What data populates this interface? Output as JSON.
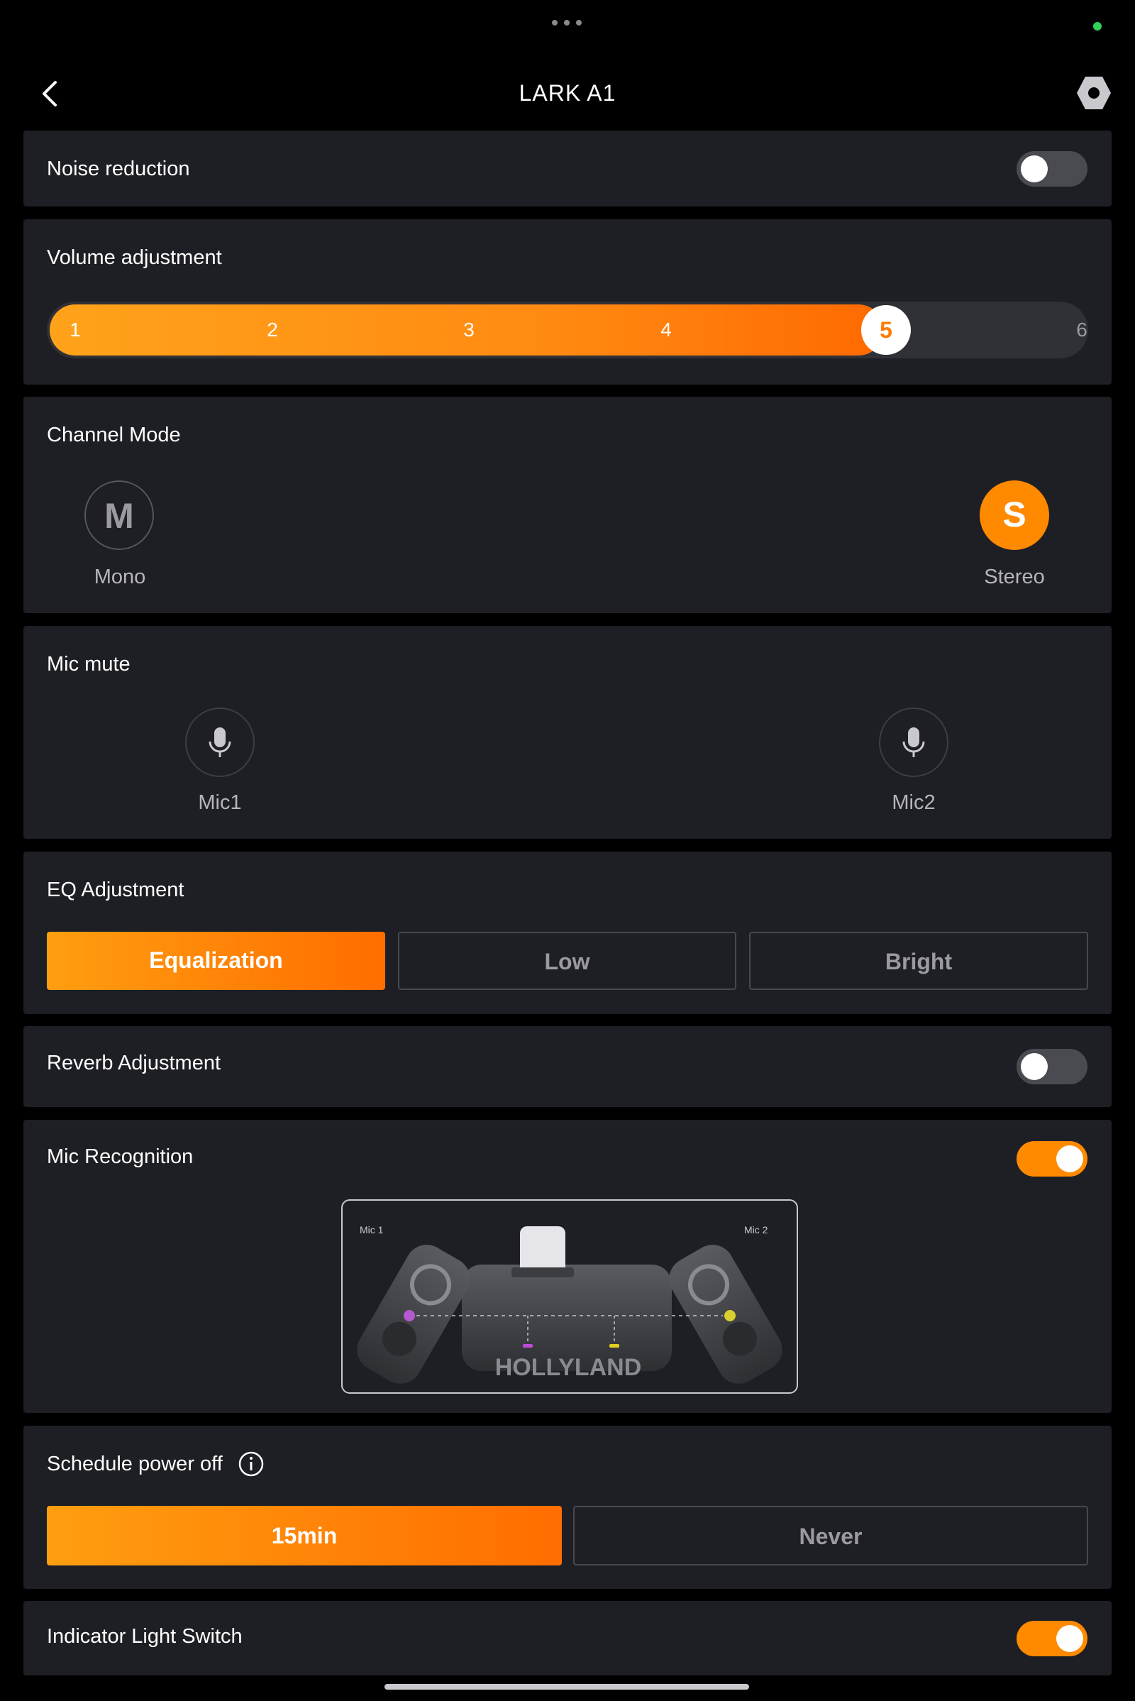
{
  "header": {
    "title": "LARK A1"
  },
  "noise_reduction": {
    "label": "Noise reduction",
    "enabled": false
  },
  "volume": {
    "label": "Volume adjustment",
    "levels": [
      "1",
      "2",
      "3",
      "4",
      "5",
      "6"
    ],
    "selected": "5"
  },
  "channel_mode": {
    "label": "Channel Mode",
    "mono": {
      "letter": "M",
      "label": "Mono",
      "selected": false
    },
    "stereo": {
      "letter": "S",
      "label": "Stereo",
      "selected": true
    }
  },
  "mic_mute": {
    "label": "Mic mute",
    "mic1": "Mic1",
    "mic2": "Mic2"
  },
  "eq": {
    "label": "EQ Adjustment",
    "options": [
      "Equalization",
      "Low",
      "Bright"
    ],
    "selected": "Equalization"
  },
  "reverb": {
    "label": "Reverb Adjustment",
    "enabled": false
  },
  "mic_recognition": {
    "label": "Mic Recognition",
    "enabled": true,
    "illustration": {
      "mic1_label": "Mic 1",
      "mic2_label": "Mic 2",
      "brand": "HOLLYLAND"
    }
  },
  "schedule_power_off": {
    "label": "Schedule power off",
    "options": [
      "15min",
      "Never"
    ],
    "selected": "15min"
  },
  "indicator_light": {
    "label": "Indicator Light Switch",
    "enabled": true
  },
  "colors": {
    "accent": "#ff8a00",
    "card_bg": "#1e1f24",
    "page_bg": "#000000",
    "status_dot": "#30d158"
  },
  "icons": [
    "back-arrow-icon",
    "settings-hex-icon",
    "microphone-icon",
    "info-icon",
    "more-dots-icon"
  ]
}
